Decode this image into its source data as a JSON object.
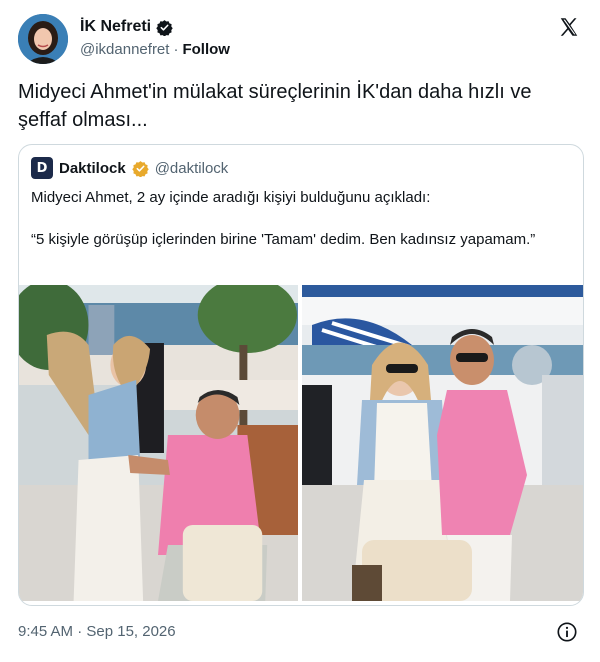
{
  "author": {
    "display_name": "İK Nefreti",
    "handle": "@ikdannefret",
    "separator": "·",
    "follow_label": "Follow",
    "verified_color": "#1d9bf0"
  },
  "tweet": {
    "text": "Midyeci Ahmet'in mülakat süreçlerinin İK'dan daha hızlı ve şeffaf olması..."
  },
  "quoted": {
    "avatar_letter": "D",
    "display_name": "Daktilock",
    "handle": "@daktilock",
    "verified_color": "#e8a92c",
    "line1": "Midyeci Ahmet, 2 ay içinde aradığı kişiyi bulduğunu açıkladı:",
    "line2": "“5 kişiyle görüşüp içlerinden birine 'Tamam' dedim. Ben kadınsız yapamam.”",
    "photos": [
      "proposal-photo",
      "couple-photo"
    ]
  },
  "footer": {
    "timestamp": "9:45 AM · Sep 15, 2026"
  },
  "icons": {
    "logo": "x-logo-icon",
    "verified": "verified-badge-icon",
    "info": "info-icon"
  }
}
